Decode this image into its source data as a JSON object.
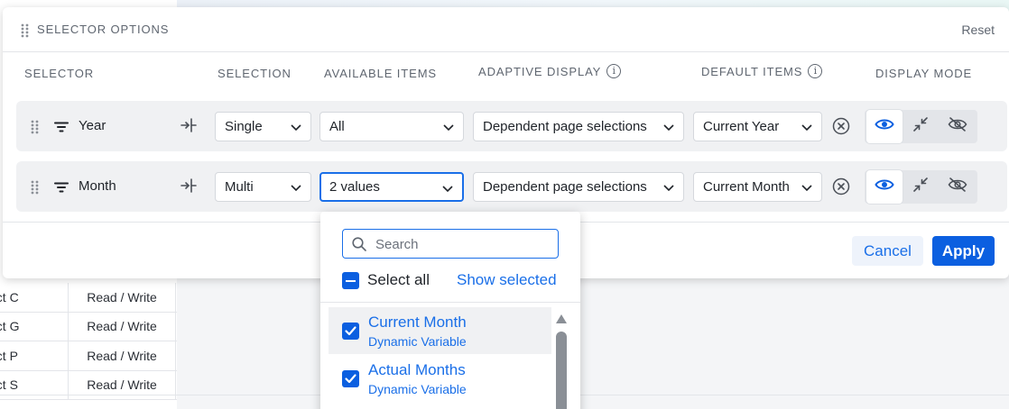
{
  "background_table": {
    "rows": [
      {
        "name": "ect C",
        "access": "Read / Write"
      },
      {
        "name": "ect G",
        "access": "Read / Write"
      },
      {
        "name": "ect P",
        "access": "Read / Write"
      },
      {
        "name": "ect S",
        "access": "Read / Write"
      }
    ]
  },
  "dialog": {
    "title": "SELECTOR OPTIONS",
    "reset_label": "Reset",
    "columns": {
      "selector": "SELECTOR",
      "selection": "SELECTION",
      "available_items": "AVAILABLE ITEMS",
      "adaptive_display": "ADAPTIVE DISPLAY",
      "default_items": "DEFAULT ITEMS",
      "display_mode": "DISPLAY MODE"
    },
    "rows": [
      {
        "name": "Year",
        "selection": "Single",
        "available": "All",
        "adaptive": "Dependent page selections",
        "default": "Current Year"
      },
      {
        "name": "Month",
        "selection": "Multi",
        "available": "2 values",
        "adaptive": "Dependent page selections",
        "default": "Current Month"
      }
    ],
    "cancel_label": "Cancel",
    "apply_label": "Apply"
  },
  "dropdown": {
    "search_placeholder": "Search",
    "select_all_label": "Select all",
    "show_selected_label": "Show selected",
    "items": [
      {
        "title": "Current Month",
        "subtitle": "Dynamic Variable",
        "checked": true
      },
      {
        "title": "Actual Months",
        "subtitle": "Dynamic Variable",
        "checked": true
      }
    ]
  },
  "colors": {
    "accent": "#0b5fe0",
    "link": "#1a6fe8",
    "row_bg": "#f0f1f3"
  }
}
